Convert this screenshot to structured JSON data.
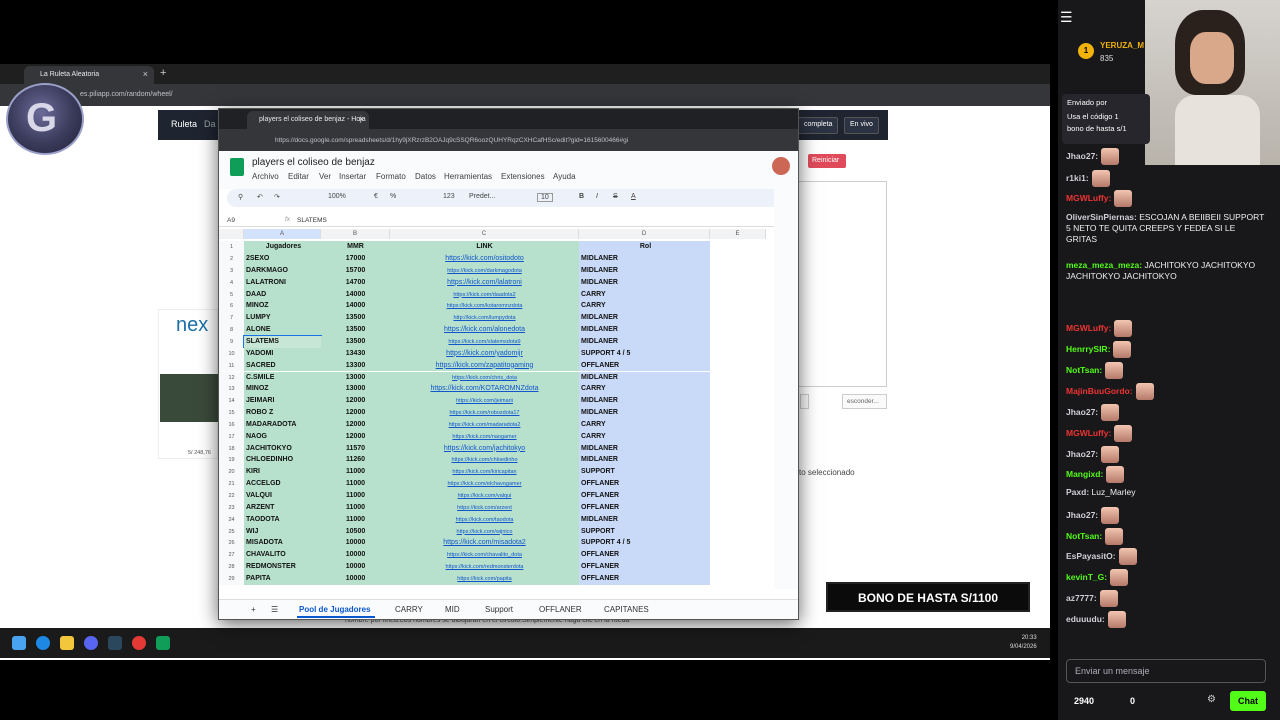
{
  "bg_browser": {
    "tab_title": "La Ruleta Aleatoria",
    "url": "es.piliapp.com/random/wheel/",
    "nav": [
      "Ruleta",
      "Da"
    ],
    "btn_completa": "completa",
    "btn_envivo": "En vivo",
    "btn_reiniciar": "Reiniciar",
    "btn_esconder": "esconder...",
    "selected_text": "to seleccionado",
    "logo_text": "nex",
    "logo_count": "5/ 248,76",
    "bottom_note": "nombre por línea.Los nombres se dibujarán en el círculo.Simplemente haga clic en la rueda"
  },
  "sheets": {
    "tab_title": "players el coliseo de benjaz - Hoja",
    "url": "https://docs.google.com/spreadsheets/d/1hy9jXRzrzB2OAJq9cSSQR6oozQUHYRqzCXHCafHSc/edit?gid=1615600466#gi",
    "doc_title": "players el coliseo de benjaz",
    "menu": [
      "Archivo",
      "Editar",
      "Ver",
      "Insertar",
      "Formato",
      "Datos",
      "Herramientas",
      "Extensiones",
      "Ayuda"
    ],
    "toolbar": {
      "zoom": "100%",
      "currency": "€",
      "percent": "%",
      "format": "123",
      "font": "Predet...",
      "size": "10"
    },
    "cell_ref": "A9",
    "formula_value": "SLATEMS",
    "col_letters": [
      "A",
      "B",
      "C",
      "D",
      "E"
    ],
    "headers": {
      "jugadores": "Jugadores",
      "mmr": "MMR",
      "link": "LINK",
      "rol": "Rol"
    },
    "rows": [
      {
        "n": "2",
        "name": "2SEXO",
        "mmr": "17000",
        "link": "https://kick.com/ositodoto",
        "rol": "MIDLANER",
        "big": true
      },
      {
        "n": "3",
        "name": "DARKMAGO",
        "mmr": "15700",
        "link": "https://kick.com/darkmagodota",
        "rol": "MIDLANER",
        "big": false
      },
      {
        "n": "4",
        "name": "LALATRONI",
        "mmr": "14700",
        "link": "https://kick.com/lalatroni",
        "rol": "MIDLANER",
        "big": true
      },
      {
        "n": "5",
        "name": "DAAD",
        "mmr": "14000",
        "link": "https://kick.com/daadota2",
        "rol": "CARRY",
        "big": false
      },
      {
        "n": "6",
        "name": "MINOZ",
        "mmr": "14000",
        "link": "https://kick.com/kotaromnzdota",
        "rol": "CARRY",
        "big": false
      },
      {
        "n": "7",
        "name": "LUMPY",
        "mmr": "13500",
        "link": "http://kick.com/lumpydota",
        "rol": "MIDLANER",
        "big": false
      },
      {
        "n": "8",
        "name": "ALONE",
        "mmr": "13500",
        "link": "https://kick.com/alonedota",
        "rol": "MIDLANER",
        "big": true
      },
      {
        "n": "9",
        "name": "SLATEMS",
        "mmr": "13500",
        "link": "https://kick.com/slatemsdota9",
        "rol": "MIDLANER",
        "big": false
      },
      {
        "n": "10",
        "name": "YADOMI",
        "mmr": "13430",
        "link": "https://kick.com/yadomijr",
        "rol": "SUPPORT 4 / 5",
        "big": true
      },
      {
        "n": "11",
        "name": "SACRED",
        "mmr": "13300",
        "link": "https://kick.com/zapatitogaming",
        "rol": "OFFLANER",
        "big": true
      },
      {
        "n": "12",
        "name": "C.SMILE",
        "mmr": "13000",
        "link": "https://kick.com/chris_dota",
        "rol": "MIDLANER",
        "big": false
      },
      {
        "n": "13",
        "name": "MINOZ",
        "mmr": "13000",
        "link": "https://kick.com/KOTAROMNZdota",
        "rol": "CARRY",
        "big": true
      },
      {
        "n": "14",
        "name": "JEIMARI",
        "mmr": "12000",
        "link": "https://kick.com/jeimarii",
        "rol": "MIDLANER",
        "big": false
      },
      {
        "n": "15",
        "name": "ROBO Z",
        "mmr": "12000",
        "link": "https://kick.com/robozdota17",
        "rol": "MIDLANER",
        "big": false
      },
      {
        "n": "16",
        "name": "MADARADOTA",
        "mmr": "12000",
        "link": "https://kick.com/madaradota2",
        "rol": "CARRY",
        "big": false
      },
      {
        "n": "17",
        "name": "NAOG",
        "mmr": "12000",
        "link": "https://kick.com/naogamer",
        "rol": "CARRY",
        "big": false
      },
      {
        "n": "18",
        "name": "JACHITOKYO",
        "mmr": "11570",
        "link": "https://kick.com/jachitokyo",
        "rol": "MIDLANER",
        "big": true
      },
      {
        "n": "19",
        "name": "CHLOEDINHO",
        "mmr": "11260",
        "link": "https://kick.com/chloedinho",
        "rol": "MIDLANER",
        "big": false
      },
      {
        "n": "20",
        "name": "KIRI",
        "mmr": "11000",
        "link": "https://kick.com/kiricapitan",
        "rol": "SUPPORT",
        "big": false
      },
      {
        "n": "21",
        "name": "ACCELGD",
        "mmr": "11000",
        "link": "https://kick.com/elchavogamer",
        "rol": "OFFLANER",
        "big": false
      },
      {
        "n": "22",
        "name": "VALQUI",
        "mmr": "11000",
        "link": "https://kick.com/valqui",
        "rol": "OFFLANER",
        "big": false
      },
      {
        "n": "23",
        "name": "ARZENT",
        "mmr": "11000",
        "link": "https://kick.com/arzent",
        "rol": "OFFLANER",
        "big": false
      },
      {
        "n": "24",
        "name": "TAODOTA",
        "mmr": "11000",
        "link": "https://kick.com/taodota",
        "rol": "MIDLANER",
        "big": false
      },
      {
        "n": "25",
        "name": "WIJ",
        "mmr": "10500",
        "link": "https://kick.com/wijnico",
        "rol": "SUPPORT",
        "big": false
      },
      {
        "n": "26",
        "name": "MISADOTA",
        "mmr": "10000",
        "link": "https://kick.com/misadota2",
        "rol": "SUPPORT 4 / 5",
        "big": true
      },
      {
        "n": "27",
        "name": "CHAVALITO",
        "mmr": "10000",
        "link": "https://kick.com/chavalito_dota",
        "rol": "OFFLANER",
        "big": false
      },
      {
        "n": "28",
        "name": "REDMONSTER",
        "mmr": "10000",
        "link": "https://kick.com/redmonsterdota",
        "rol": "OFFLANER",
        "big": false
      },
      {
        "n": "29",
        "name": "PAPITA",
        "mmr": "10000",
        "link": "https://kick.com/papita",
        "rol": "OFFLANER",
        "big": false
      }
    ],
    "sheet_tabs": [
      "Pool de Jugadores",
      "CARRY",
      "MID",
      "Support",
      "OFFLANER",
      "CAPITANES"
    ]
  },
  "chat": {
    "rank_badge": "1",
    "rank_name": "YERUZA_M",
    "rank_points": "835",
    "pinned": [
      "Enviado por",
      "Usa el código 1",
      "bono de hasta s/1"
    ],
    "messages": [
      {
        "user": "Jhao27:",
        "color": "#cfcfd6",
        "text": "",
        "emote": true
      },
      {
        "user": "r1ki1:",
        "color": "#cfcfd6",
        "text": "",
        "emote": true
      },
      {
        "user": "MGWLuffy:",
        "color": "#e33",
        "text": "",
        "emote": true
      },
      {
        "user": "OliverSinPiernas:",
        "color": "#cfcfd6",
        "text": "ESCOJAN A BEIIBEII SUPPORT 5 NETO TE QUITA CREEPS Y FEDEA SI LE GRITAS",
        "emote": false
      },
      {
        "user": "meza_meza_meza:",
        "color": "#53fc18",
        "text": "JACHITOKYO JACHITOKYO JACHITOKYO JACHITOKYO",
        "emote": false
      },
      {
        "user": "MGWLuffy:",
        "color": "#e33",
        "text": "",
        "emote": true
      },
      {
        "user": "HenrrySIR:",
        "color": "#53fc18",
        "text": "",
        "emote": true
      },
      {
        "user": "NotTsan:",
        "color": "#53fc18",
        "text": "",
        "emote": true
      },
      {
        "user": "MajinBuuGordo:",
        "color": "#e33",
        "text": "",
        "emote": true
      },
      {
        "user": "Jhao27:",
        "color": "#cfcfd6",
        "text": "",
        "emote": true
      },
      {
        "user": "MGWLuffy:",
        "color": "#e33",
        "text": "",
        "emote": true
      },
      {
        "user": "Jhao27:",
        "color": "#cfcfd6",
        "text": "",
        "emote": true
      },
      {
        "user": "Mangixd:",
        "color": "#53fc18",
        "text": "",
        "emote": true
      },
      {
        "user": "Paxd:",
        "color": "#cfcfd6",
        "text": "Luz_Marley",
        "emote": false
      },
      {
        "user": "Jhao27:",
        "color": "#cfcfd6",
        "text": "",
        "emote": true
      },
      {
        "user": "NotTsan:",
        "color": "#53fc18",
        "text": "",
        "emote": true
      },
      {
        "user": "EsPayasitO:",
        "color": "#cfcfd6",
        "text": "",
        "emote": true
      },
      {
        "user": "kevinT_G:",
        "color": "#53fc18",
        "text": "",
        "emote": true
      },
      {
        "user": "az7777:",
        "color": "#cfcfd6",
        "text": "",
        "emote": true
      },
      {
        "user": "eduuudu:",
        "color": "#cfcfd6",
        "text": "",
        "emote": true
      }
    ],
    "input_placeholder": "Enviar un mensaje",
    "points": "2940",
    "zero": "0",
    "chat_button": "Chat"
  },
  "overlay": {
    "banner": "BONO DE HASTA S/1100"
  },
  "taskbar": {
    "time": "20:33",
    "date": "9/04/2026"
  }
}
